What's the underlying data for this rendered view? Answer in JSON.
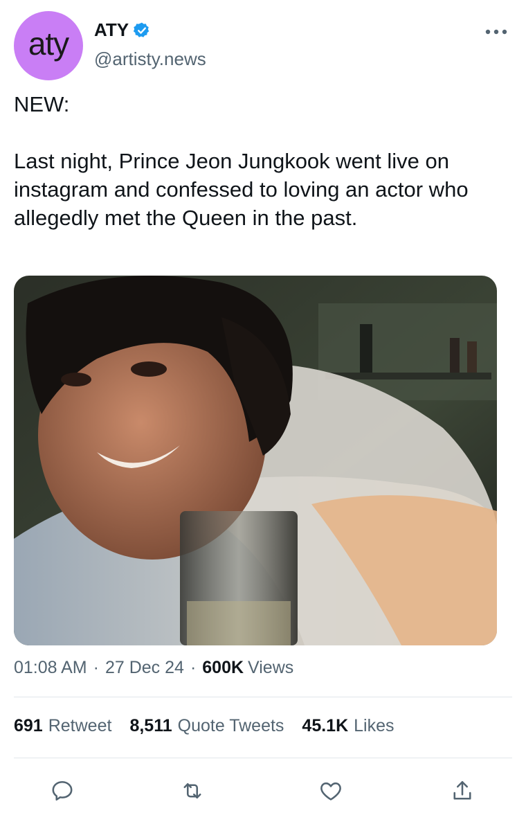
{
  "author": {
    "avatar_text": "aty",
    "display_name": "ATY",
    "handle": "@artisty.news",
    "verified_icon": "verified-badge-icon",
    "avatar_color": "#c97ef5"
  },
  "tweet": {
    "text": "NEW:\n\nLast night, Prince Jeon Jungkook went live on instagram and confessed to loving an actor who allegedly met the Queen in the past."
  },
  "meta": {
    "time": "01:08 AM",
    "separator": "·",
    "date": "27 Dec 24",
    "views_count": "600K",
    "views_label": "Views"
  },
  "stats": {
    "retweets_count": "691",
    "retweets_label": "Retweet",
    "quotes_count": "8,511",
    "quotes_label": "Quote Tweets",
    "likes_count": "45.1K",
    "likes_label": "Likes"
  },
  "actions": {
    "reply_icon": "reply-icon",
    "retweet_icon": "retweet-icon",
    "like_icon": "heart-icon",
    "share_icon": "share-icon"
  },
  "colors": {
    "accent": "#1d9bf0",
    "muted_text": "#536471",
    "divider": "#e1e6ea"
  }
}
